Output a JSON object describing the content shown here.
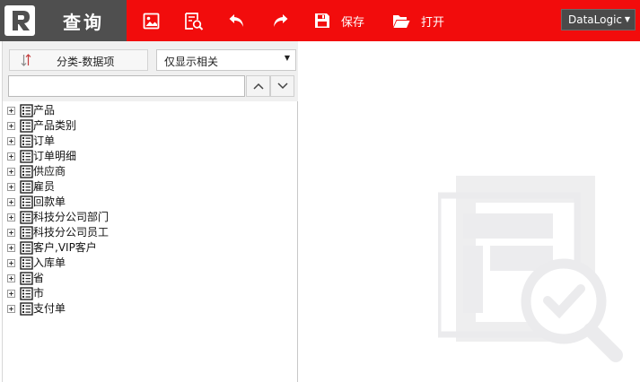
{
  "app": {
    "logo_letter": "R",
    "title": "查询"
  },
  "toolbar": {
    "chart_icon": "chart-icon",
    "preview_icon": "preview-icon",
    "undo_icon": "undo-icon",
    "redo_icon": "redo-icon",
    "save_label": "保存",
    "open_label": "打开"
  },
  "datasource": {
    "selected": "DataLogic"
  },
  "left_panel": {
    "category_button_label": "分类-数据项",
    "filter_selected": "仅显示相关",
    "search": {
      "value": "",
      "placeholder": ""
    },
    "tree_items": [
      {
        "label": "产品"
      },
      {
        "label": "产品类别"
      },
      {
        "label": "订单"
      },
      {
        "label": "订单明细"
      },
      {
        "label": "供应商"
      },
      {
        "label": "雇员"
      },
      {
        "label": "回款单"
      },
      {
        "label": "科技分公司部门"
      },
      {
        "label": "科技分公司员工"
      },
      {
        "label": "客户,VIP客户"
      },
      {
        "label": "入库单"
      },
      {
        "label": "省"
      },
      {
        "label": "市"
      },
      {
        "label": "支付单"
      }
    ]
  },
  "colors": {
    "topbar_red": "#f20c0c",
    "brand_gray": "#4f4f4f",
    "panel_gray": "#f0f0f0",
    "illustration_gray": "#ececee"
  }
}
